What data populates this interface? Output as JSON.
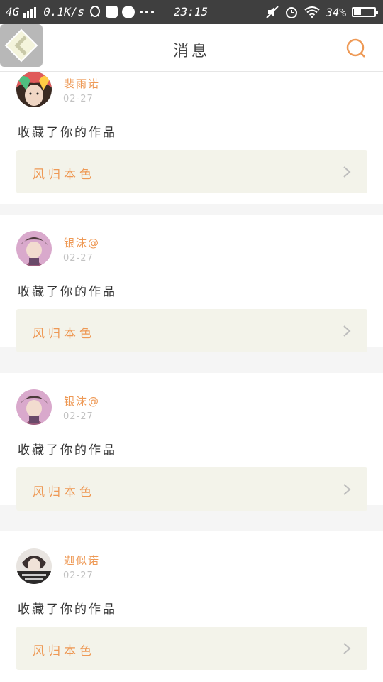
{
  "status_bar": {
    "network": "4G",
    "speed": "0.1K/s",
    "time": "23:15",
    "battery": "34%",
    "battery_level": 0.34,
    "icons": [
      "signal-icon",
      "qq-icon",
      "tray-icon",
      "message-icon",
      "more-icon",
      "mute-icon",
      "alarm-icon",
      "wifi-icon",
      "battery-icon"
    ]
  },
  "header": {
    "title": "消息",
    "back_icon": "back-diamond-icon",
    "search_icon": "search-icon"
  },
  "colors": {
    "accent": "#ee9955",
    "card_bg": "#ffffff",
    "bar_bg": "#f3f3ea",
    "separator": "#f5f5f5"
  },
  "feed": [
    {
      "username": "裴雨诺",
      "date": "02-27",
      "action": "收藏了你的作品",
      "work": "风归本色",
      "avatar_icon": "avatar-icon"
    },
    {
      "username": "银沫@",
      "date": "02-27",
      "action": "收藏了你的作品",
      "work": "风归本色",
      "avatar_icon": "avatar-icon"
    },
    {
      "username": "银沫@",
      "date": "02-27",
      "action": "收藏了你的作品",
      "work": "风归本色",
      "avatar_icon": "avatar-icon"
    },
    {
      "username": "迦似诺",
      "date": "02-27",
      "action": "收藏了你的作品",
      "work": "风归本色",
      "avatar_icon": "avatar-icon"
    }
  ]
}
